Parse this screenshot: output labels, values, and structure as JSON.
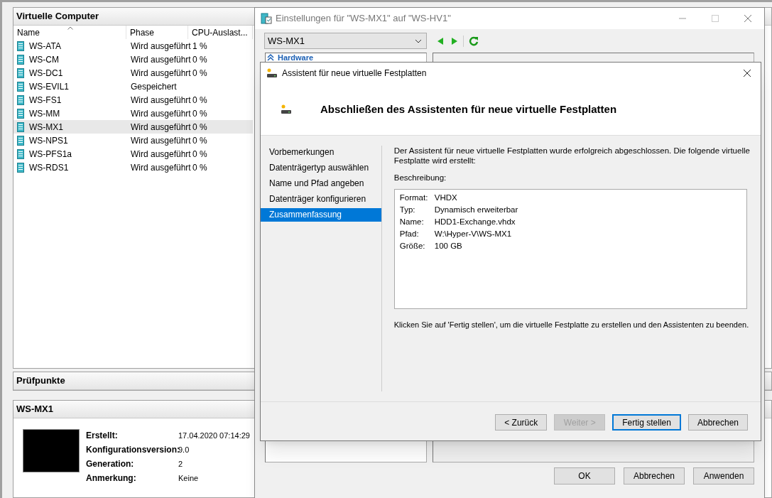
{
  "manager": {
    "vm_panel": {
      "title": "Virtuelle Computer",
      "columns": [
        "Name",
        "Phase",
        "CPU-Auslast..."
      ],
      "rows": [
        {
          "name": "WS-ATA",
          "phase": "Wird ausgeführt",
          "cpu": "1 %",
          "selected": false
        },
        {
          "name": "WS-CM",
          "phase": "Wird ausgeführt",
          "cpu": "0 %",
          "selected": false
        },
        {
          "name": "WS-DC1",
          "phase": "Wird ausgeführt",
          "cpu": "0 %",
          "selected": false
        },
        {
          "name": "WS-EVIL1",
          "phase": "Gespeichert",
          "selected": false
        },
        {
          "name": "WS-FS1",
          "phase": "Wird ausgeführt",
          "cpu": "0 %",
          "selected": false
        },
        {
          "name": "WS-MM",
          "phase": "Wird ausgeführt",
          "cpu": "0 %",
          "selected": false
        },
        {
          "name": "WS-MX1",
          "phase": "Wird ausgeführt",
          "cpu": "0 %",
          "selected": true
        },
        {
          "name": "WS-NPS1",
          "phase": "Wird ausgeführt",
          "cpu": "0 %",
          "selected": false
        },
        {
          "name": "WS-PFS1a",
          "phase": "Wird ausgeführt",
          "cpu": "0 %",
          "selected": false
        },
        {
          "name": "WS-RDS1",
          "phase": "Wird ausgeführt",
          "cpu": "0 %",
          "selected": false
        }
      ]
    },
    "checkpoints_panel": {
      "title": "Prüfpunkte"
    },
    "details_panel": {
      "title": "WS-MX1",
      "fields": [
        {
          "label": "Erstellt:",
          "value": "17.04.2020 07:14:29"
        },
        {
          "label": "Konfigurationsversion:",
          "value": "9.0"
        },
        {
          "label": "Generation:",
          "value": "2"
        },
        {
          "label": "Anmerkung:",
          "value": "Keine"
        }
      ]
    }
  },
  "settings_window": {
    "title": "Einstellungen für \"WS-MX1\" auf \"WS-HV1\"",
    "vm_select": {
      "value": "WS-MX1"
    },
    "tree_heading": "Hardware",
    "buttons": [
      {
        "label": "OK"
      },
      {
        "label": "Abbrechen"
      },
      {
        "label": "Anwenden"
      }
    ]
  },
  "wizard": {
    "title": "Assistent für neue virtuelle Festplatten",
    "heading": "Abschließen des Assistenten für neue virtuelle Festplatten",
    "steps": [
      {
        "label": "Vorbemerkungen",
        "selected": false
      },
      {
        "label": "Datenträgertyp auswählen",
        "selected": false
      },
      {
        "label": "Name und Pfad angeben",
        "selected": false
      },
      {
        "label": "Datenträger konfigurieren",
        "selected": false
      },
      {
        "label": "Zusammenfassung",
        "selected": true
      }
    ],
    "intro": "Der Assistent für neue virtuelle Festplatten wurde erfolgreich abgeschlossen. Die folgende virtuelle Festplatte wird erstellt:",
    "description_label": "Beschreibung:",
    "summary": [
      {
        "label": "Format:",
        "value": "VHDX"
      },
      {
        "label": "Typ:",
        "value": "Dynamisch erweiterbar"
      },
      {
        "label": "Name:",
        "value": "HDD1-Exchange.vhdx"
      },
      {
        "label": "Pfad:",
        "value": "W:\\Hyper-V\\WS-MX1"
      },
      {
        "label": "Größe:",
        "value": "100 GB"
      }
    ],
    "instruction": "Klicken Sie auf 'Fertig stellen', um die virtuelle Festplatte zu erstellen und den Assistenten zu beenden.",
    "buttons": [
      {
        "label": "< Zurück",
        "disabled": false,
        "default": false
      },
      {
        "label": "Weiter >",
        "disabled": true,
        "default": false
      },
      {
        "label": "Fertig stellen",
        "disabled": false,
        "default": true
      },
      {
        "label": "Abbrechen",
        "disabled": false,
        "default": false
      }
    ]
  }
}
